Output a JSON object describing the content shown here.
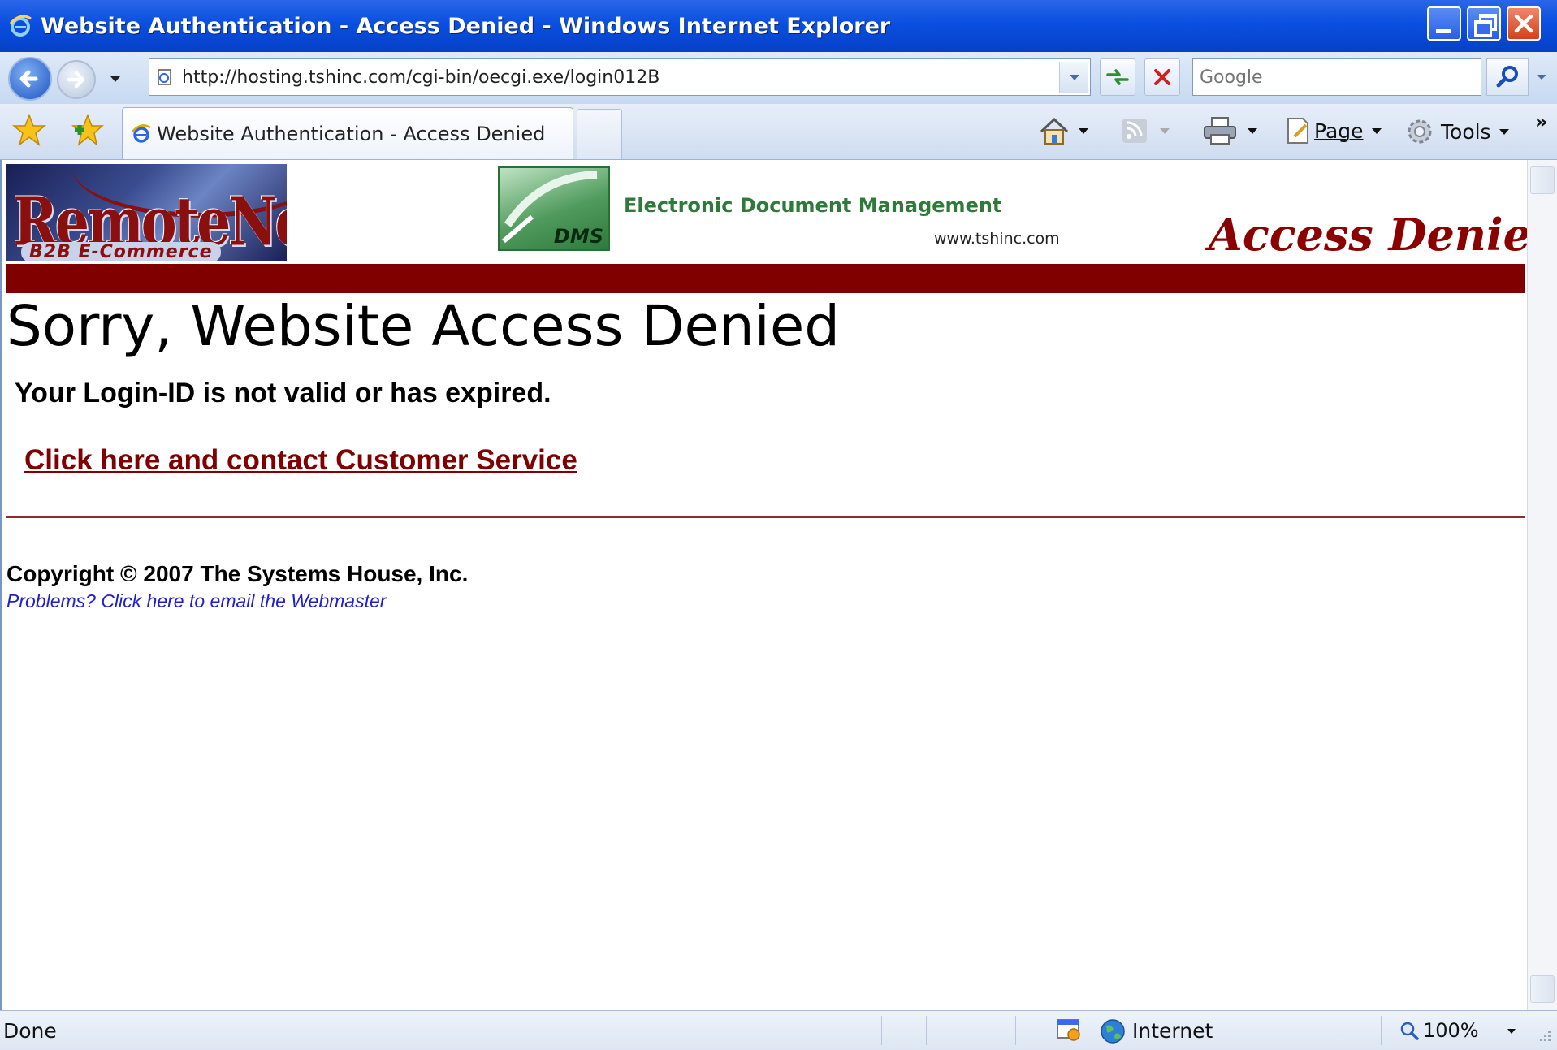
{
  "window": {
    "title": "Website Authentication - Access Denied - Windows Internet Explorer"
  },
  "navbar": {
    "address_url": "http://hosting.tshinc.com/cgi-bin/oecgi.exe/login012B",
    "search_placeholder": "Google"
  },
  "tabs": [
    {
      "label": "Website Authentication - Access Denied",
      "active": true
    }
  ],
  "command_bar": {
    "page_label": "Page",
    "tools_label": "Tools",
    "more_label": "»"
  },
  "banner": {
    "remotenet_logo": "RemoteNet",
    "remotenet_sub": "B2B E-Commerce",
    "dms_logo": "DMS",
    "edm_title": "Electronic Document Management",
    "edm_url": "www.tshinc.com",
    "access_denied": "Access Denied",
    "bar_color": "#800000"
  },
  "content": {
    "heading": "Sorry, Website Access Denied",
    "invalid_message": "Your Login-ID is not valid or has expired.",
    "contact_link": "Click here and contact Customer Service",
    "copyright": "Copyright © 2007 The Systems House, Inc.",
    "webmaster_link": "Problems? Click here to email the Webmaster"
  },
  "statusbar": {
    "status": "Done",
    "zone": "Internet",
    "zoom": "100%"
  },
  "icons": {
    "browser": "ie-icon",
    "back": "back-arrow-icon",
    "forward": "forward-arrow-icon",
    "refresh": "refresh-icon",
    "stop": "stop-icon",
    "search": "magnifier-icon",
    "favorites": "star-icon",
    "add_favorites": "add-favorite-icon",
    "home": "home-icon",
    "feeds": "rss-feed-icon",
    "print": "printer-icon",
    "page": "page-icon",
    "tools": "gear-icon",
    "zone": "globe-icon",
    "zoom": "zoom-icon"
  }
}
